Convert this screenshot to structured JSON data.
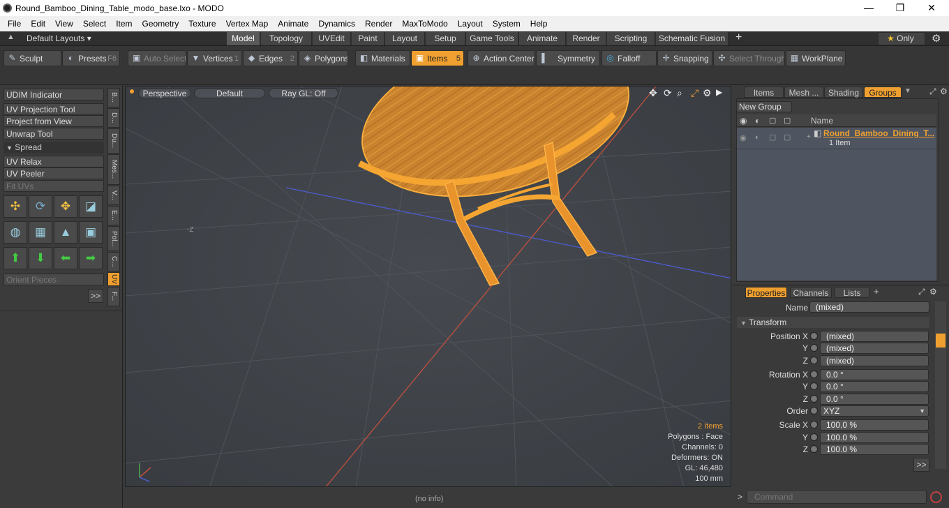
{
  "titlebar": {
    "title": "Round_Bamboo_Dining_Table_modo_base.lxo - MODO",
    "minimize": "—",
    "maximize": "❐",
    "close": "✕"
  },
  "menu": [
    "File",
    "Edit",
    "View",
    "Select",
    "Item",
    "Geometry",
    "Texture",
    "Vertex Map",
    "Animate",
    "Dynamics",
    "Render",
    "MaxToModo",
    "Layout",
    "System",
    "Help"
  ],
  "layouts": {
    "label": "Default Layouts ▾"
  },
  "tabs": [
    "Model",
    "Topology",
    "UVEdit",
    "Paint",
    "Layout",
    "Setup",
    "Game Tools",
    "Animate",
    "Render",
    "Scripting",
    "Schematic Fusion"
  ],
  "tab_plus": "+",
  "only": "Only",
  "toolbar": {
    "sculpt": "Sculpt",
    "presets": "Presets",
    "presets_key": "F6",
    "auto_select": "Auto Select",
    "vertices": "Vertices",
    "vertices_key": "1",
    "edges": "Edges",
    "edges_key": "2",
    "polygons": "Polygons",
    "materials": "Materials",
    "items": "Items",
    "items_key": "5",
    "action_center": "Action Center",
    "symmetry": "Symmetry",
    "falloff": "Falloff",
    "snapping": "Snapping",
    "select_through": "Select Through",
    "workplane": "WorkPlane"
  },
  "left": {
    "udim": "UDIM Indicator",
    "uv_projection": "UV Projection Tool",
    "project_view": "Project from View",
    "unwrap": "Unwrap Tool",
    "spread": "Spread",
    "uv_relax": "UV Relax",
    "uv_peeler": "UV Peeler",
    "fit_uvs": "Fit UVs",
    "orient": "Orient Pieces",
    "more": ">>",
    "vtabs": [
      "B...",
      "D...",
      "Du...",
      "Mes...",
      "V...",
      "E...",
      "Pol...",
      "C...",
      "UV",
      "F..."
    ]
  },
  "viewport": {
    "perspective": "Perspective",
    "default": "Default",
    "raygl": "Ray GL: Off",
    "axis_label": "-Z",
    "stats": {
      "items": "2 Items",
      "polygons": "Polygons : Face",
      "channels": "Channels: 0",
      "deformers": "Deformers: ON",
      "gl": "GL: 46,480",
      "size": "100 mm"
    }
  },
  "status": {
    "info": "(no info)"
  },
  "groups": {
    "tabs": [
      "Items",
      "Mesh ...",
      "Shading",
      "Groups"
    ],
    "new_group": "New Group",
    "col_name": "Name",
    "item_name": "Round_Bamboo_Dining_T...",
    "item_count": "1 Item"
  },
  "properties": {
    "tabs": [
      "Properties",
      "Channels",
      "Lists"
    ],
    "name_label": "Name",
    "name_value": "(mixed)",
    "transform": "Transform",
    "position_x_label": "Position X",
    "position_x": "(mixed)",
    "position_y": "(mixed)",
    "position_z": "(mixed)",
    "rotation_x_label": "Rotation X",
    "rotation_x": "0.0 °",
    "rotation_y": "0.0 °",
    "rotation_z": "0.0 °",
    "order_label": "Order",
    "order": "XYZ",
    "scale_x_label": "Scale X",
    "scale_x": "100.0 %",
    "scale_y": "100.0 %",
    "scale_z": "100.0 %",
    "y": "Y",
    "z": "Z",
    "more": ">>"
  },
  "command": {
    "prompt": ">",
    "placeholder": "Command"
  },
  "colors": {
    "accent": "#f0a030",
    "wire": "#f5a531",
    "wood": "#c9822e"
  }
}
